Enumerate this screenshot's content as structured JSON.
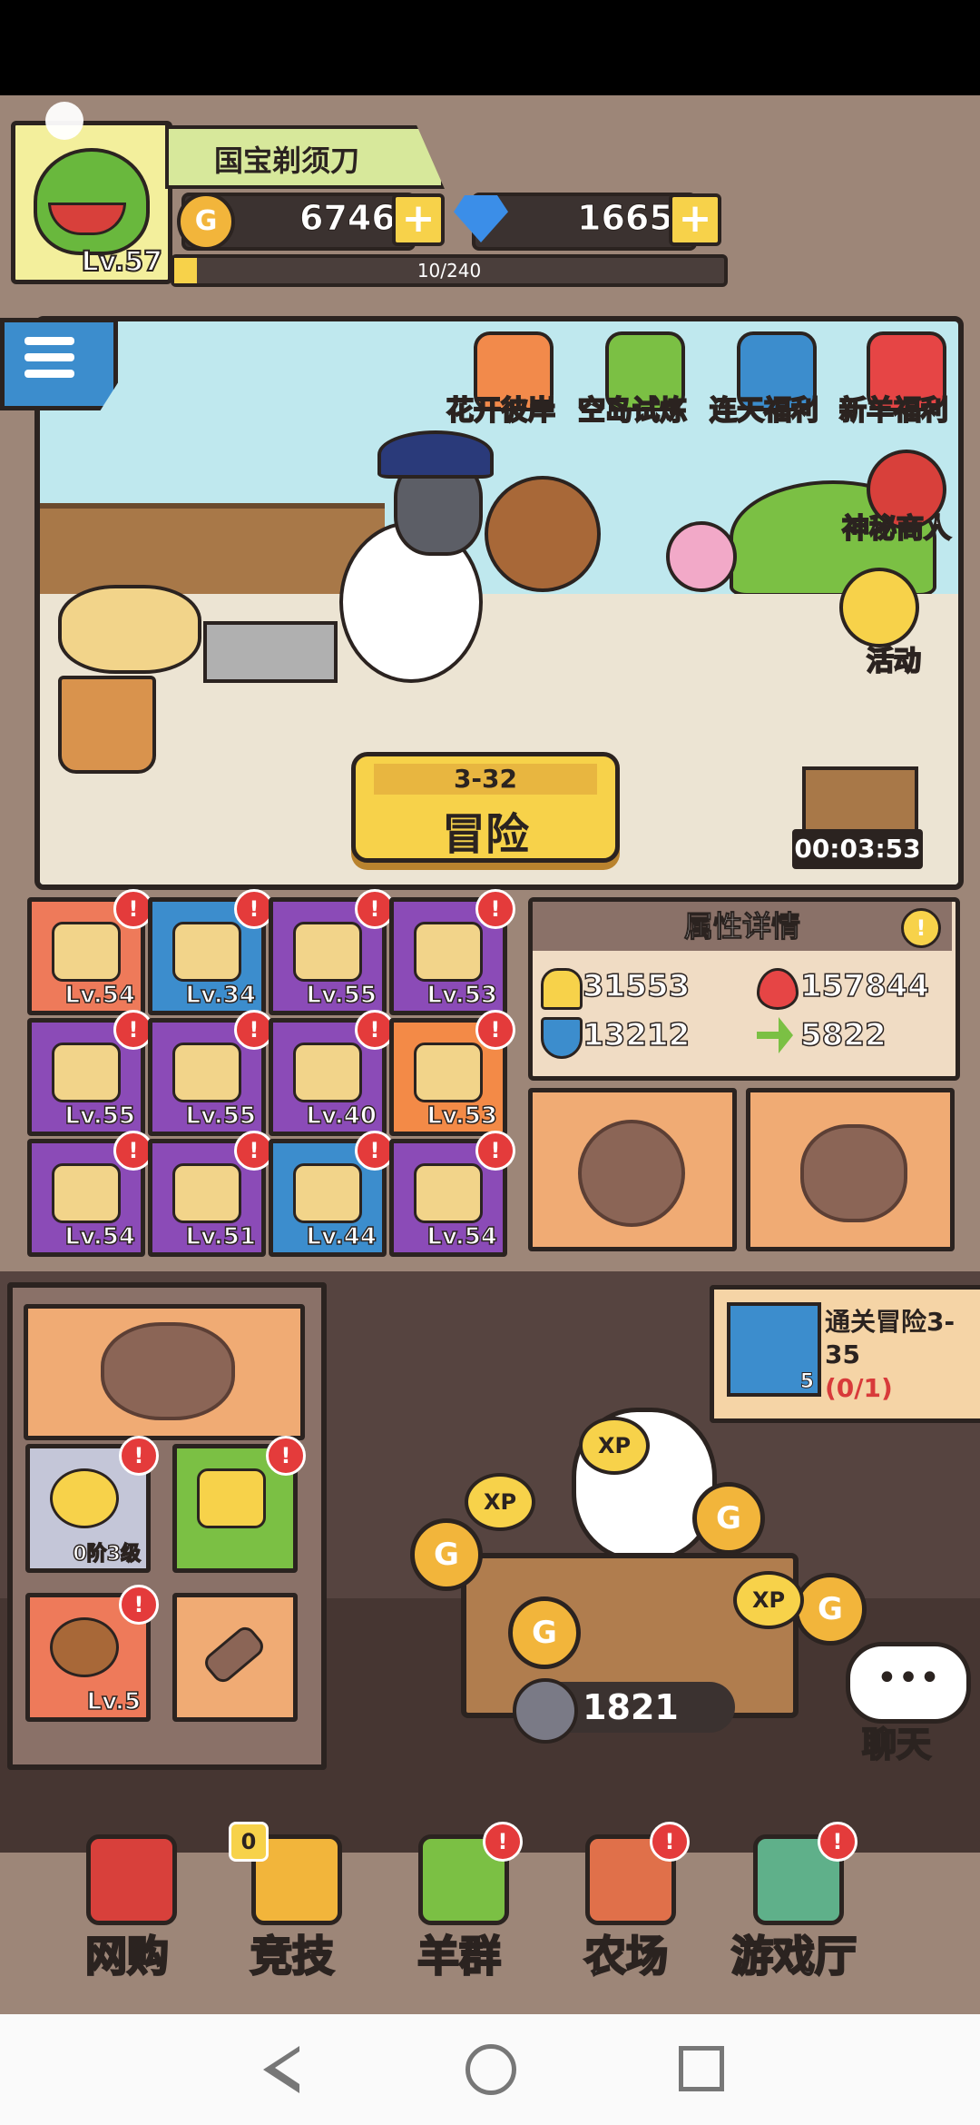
{
  "profile": {
    "name": "国宝剃须刀",
    "level": "Lv.57"
  },
  "resources": {
    "coins": "6746",
    "coin_symbol": "G",
    "gems": "1665",
    "plus": "+"
  },
  "xp": {
    "text": "10/240",
    "fraction": 0.042
  },
  "events": [
    {
      "label": "花开彼岸",
      "color": "#f28a4b"
    },
    {
      "label": "空岛试炼",
      "color": "#7bc044"
    },
    {
      "label": "连天福利",
      "color": "#3c8dcd"
    },
    {
      "label": "新羊福利",
      "color": "#e64545"
    },
    {
      "label": "神秘商人",
      "color": "#d8403b"
    },
    {
      "label": "活动",
      "color": "#f7d24a"
    }
  ],
  "adventure": {
    "stage": "3-32",
    "label": "冒险",
    "timer": "00:03:53"
  },
  "equipment": [
    {
      "level": "Lv.54",
      "color": "c-red",
      "icon": "feather-icon"
    },
    {
      "level": "Lv.34",
      "color": "c-blue",
      "icon": "stop-sign-icon"
    },
    {
      "level": "Lv.55",
      "color": "c-purple",
      "icon": "bucket-icon"
    },
    {
      "level": "Lv.53",
      "color": "c-purple",
      "icon": "trough-icon"
    },
    {
      "level": "Lv.55",
      "color": "c-purple",
      "icon": "stump-icon"
    },
    {
      "level": "Lv.55",
      "color": "c-purple",
      "icon": "hay-icon"
    },
    {
      "level": "Lv.40",
      "color": "c-purple",
      "icon": "flower-icon"
    },
    {
      "level": "Lv.53",
      "color": "c-orange",
      "icon": "bush-icon"
    },
    {
      "level": "Lv.54",
      "color": "c-purple",
      "icon": "broccoli-icon"
    },
    {
      "level": "Lv.51",
      "color": "c-purple",
      "icon": "signpost-icon"
    },
    {
      "level": "Lv.44",
      "color": "c-blue",
      "icon": "pitchfork-icon"
    },
    {
      "level": "Lv.54",
      "color": "c-purple",
      "icon": "fence-icon"
    }
  ],
  "alert_symbol": "!",
  "stats": {
    "title": "属性详情",
    "attack": "31553",
    "hp": "157844",
    "defense": "13212",
    "speed": "5822"
  },
  "left_panel": {
    "halo_label": "0阶3级",
    "pet_level": "Lv.5"
  },
  "quest": {
    "title": "通关冒险3-35",
    "count": "5",
    "progress": "(0/1)"
  },
  "farm": {
    "counter": "1821",
    "xp_label": "XP"
  },
  "chat": {
    "label": "聊天",
    "bubble": "•••"
  },
  "nav": [
    {
      "label": "网购",
      "icon": "basket-icon",
      "color": "#d8403b",
      "badge": ""
    },
    {
      "label": "竞技",
      "icon": "trophy-icon",
      "color": "#f2b53b",
      "badge": "0"
    },
    {
      "label": "羊群",
      "icon": "flock-icon",
      "color": "#7bc044",
      "badge": "!"
    },
    {
      "label": "农场",
      "icon": "barn-icon",
      "color": "#e0704a",
      "badge": "!"
    },
    {
      "label": "游戏厅",
      "icon": "arcade-icon",
      "color": "#5fb08a",
      "badge": "!"
    }
  ]
}
